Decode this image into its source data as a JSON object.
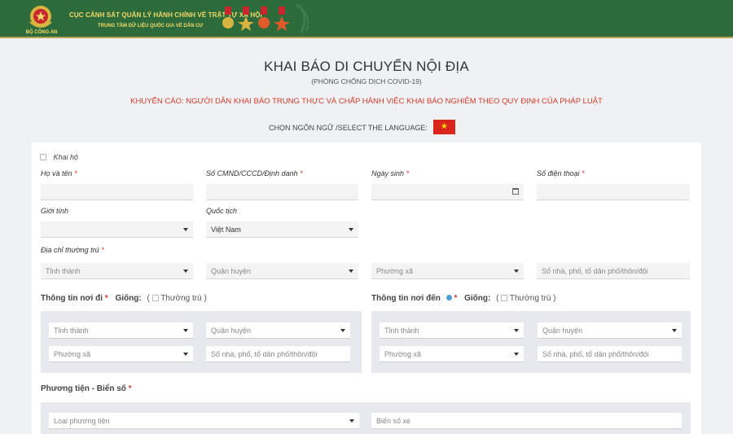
{
  "header": {
    "emblem_label": "BỘ CÔNG AN",
    "org_line1": "CỤC CẢNH SÁT QUẢN LÝ HÀNH CHÍNH VỀ TRẬT TỰ XÃ HỘI",
    "org_line2": "TRUNG TÂM DỮ LIỆU QUỐC GIA VỀ DÂN CƯ",
    "colors": {
      "bar": "#2d6b3a",
      "text": "#f3d96a"
    }
  },
  "page": {
    "title": "KHAI BÁO DI CHUYỂN NỘI ĐỊA",
    "subtitle": "(PHÒNG CHỐNG DỊCH COVID-19)",
    "warning": "KHUYẾN CÁO: NGƯỜI DÂN KHAI BÁO TRUNG THỰC VÀ CHẤP HÀNH VIỆC KHAI BÁO NGHIÊM THEO QUY ĐỊNH CỦA PHÁP LUẬT",
    "language_label": "CHỌN NGÔN NGỮ /SELECT THE LANGUAGE:",
    "flag_icon": "vietnam-flag-icon",
    "warning_color": "#d73a2a"
  },
  "form": {
    "on_behalf_label": "Khai hộ",
    "required_mark": "*",
    "full_name_label": "Họ và tên",
    "id_label": "Số CMND/CCCD/Định danh",
    "dob_label": "Ngày sinh",
    "phone_label": "Số điện thoại",
    "gender_label": "Giới tính",
    "nationality_label": "Quốc tịch",
    "nationality_value": "Việt Nam",
    "address_label": "Địa chỉ thường trú",
    "province_placeholder": "Tỉnh thành",
    "district_placeholder": "Quận huyện",
    "ward_placeholder": "Phường xã",
    "street_placeholder": "Số nhà, phố, tổ dân phố/thôn/đội",
    "departure_title": "Thông tin nơi đi",
    "destination_title": "Thông tin nơi đến",
    "same_as_label": "Giống:",
    "open_paren": "(",
    "close_paren": ")",
    "permanent_label": "Thường trú",
    "vehicle_title": "Phương tiện - Biển số",
    "vehicle_type_placeholder": "Loại phương tiện",
    "plate_placeholder": "Biển số xe"
  }
}
